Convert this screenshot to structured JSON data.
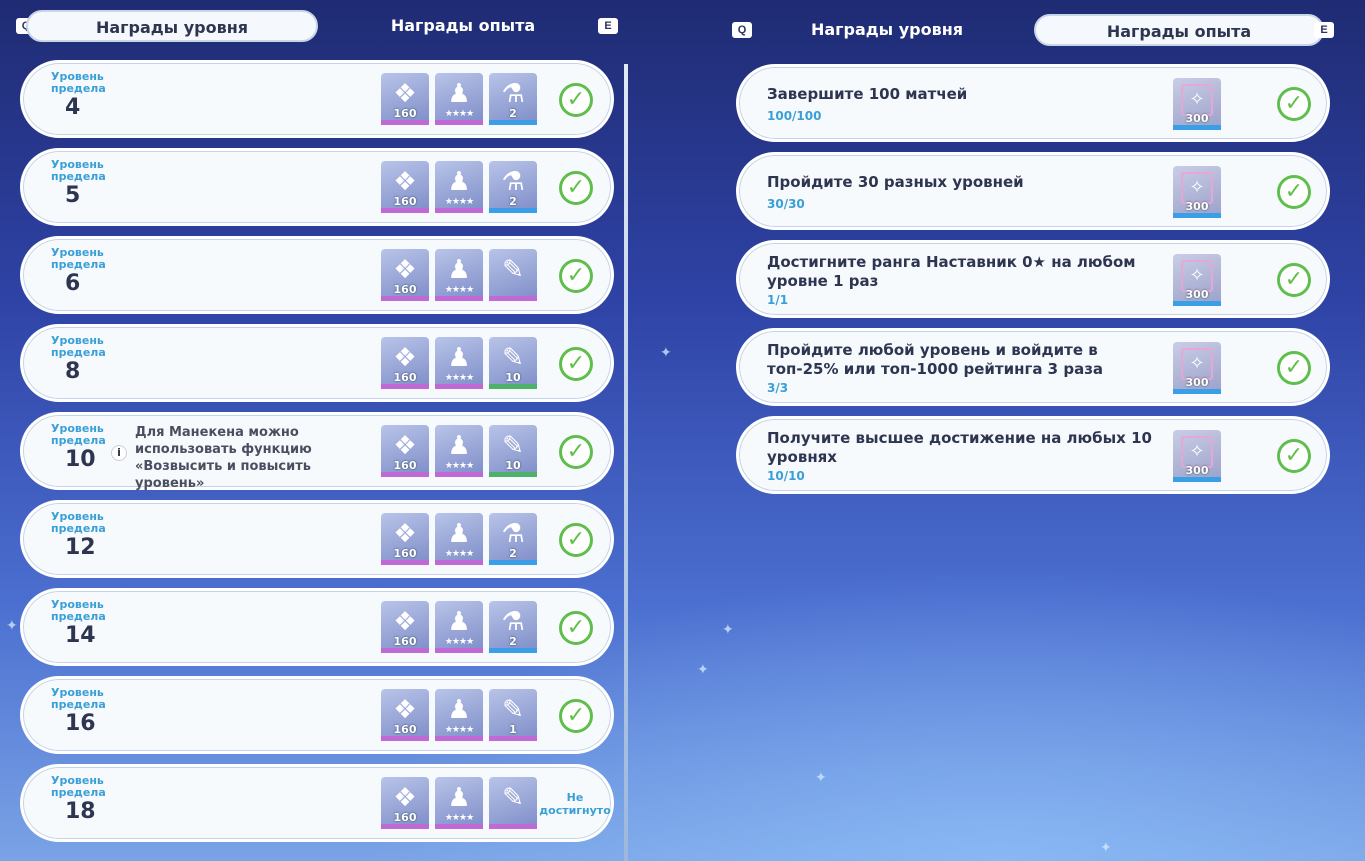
{
  "colors": {
    "accent": "#3a9fd6",
    "check": "#5fbf4c",
    "bar_purple": "#c06ad6",
    "bar_blue": "#3a9fe6",
    "bar_green": "#4cb26a"
  },
  "left": {
    "key_prev": "Q",
    "key_next": "E",
    "tabs": [
      {
        "label": "Награды уровня",
        "active": true
      },
      {
        "label": "Награды опыта",
        "active": false
      }
    ],
    "level_label": "Уровень предела",
    "rows": [
      {
        "level": "4",
        "items": [
          {
            "icon": "crystal-icon",
            "count": "160",
            "bar": "purple"
          },
          {
            "icon": "outfit-icon",
            "count": "★★★★",
            "bar": "purple"
          },
          {
            "icon": "potion-icon",
            "count": "2",
            "bar": "blue"
          }
        ],
        "status": "done"
      },
      {
        "level": "5",
        "items": [
          {
            "icon": "crystal-icon",
            "count": "160",
            "bar": "purple"
          },
          {
            "icon": "outfit-icon",
            "count": "★★★★",
            "bar": "purple"
          },
          {
            "icon": "potion-icon",
            "count": "2",
            "bar": "blue"
          }
        ],
        "status": "done"
      },
      {
        "level": "6",
        "items": [
          {
            "icon": "crystal-icon",
            "count": "160",
            "bar": "purple"
          },
          {
            "icon": "outfit-icon",
            "count": "★★★★",
            "bar": "purple"
          },
          {
            "icon": "brush-icon",
            "count": "",
            "bar": "purple"
          }
        ],
        "status": "done"
      },
      {
        "level": "8",
        "items": [
          {
            "icon": "crystal-icon",
            "count": "160",
            "bar": "purple"
          },
          {
            "icon": "outfit-icon",
            "count": "★★★★",
            "bar": "purple"
          },
          {
            "icon": "brush-icon",
            "count": "10",
            "bar": "green"
          }
        ],
        "status": "done"
      },
      {
        "level": "10",
        "note": "Для Манекена можно использовать функцию «Возвысить и повысить уровень»",
        "items": [
          {
            "icon": "crystal-icon",
            "count": "160",
            "bar": "purple"
          },
          {
            "icon": "outfit-icon",
            "count": "★★★★",
            "bar": "purple"
          },
          {
            "icon": "brush-icon",
            "count": "10",
            "bar": "green"
          }
        ],
        "status": "done"
      },
      {
        "level": "12",
        "items": [
          {
            "icon": "crystal-icon",
            "count": "160",
            "bar": "purple"
          },
          {
            "icon": "outfit-icon",
            "count": "★★★★",
            "bar": "purple"
          },
          {
            "icon": "potion-icon",
            "count": "2",
            "bar": "blue"
          }
        ],
        "status": "done"
      },
      {
        "level": "14",
        "items": [
          {
            "icon": "crystal-icon",
            "count": "160",
            "bar": "purple"
          },
          {
            "icon": "outfit-icon",
            "count": "★★★★",
            "bar": "purple"
          },
          {
            "icon": "potion-icon",
            "count": "2",
            "bar": "blue"
          }
        ],
        "status": "done"
      },
      {
        "level": "16",
        "items": [
          {
            "icon": "crystal-icon",
            "count": "160",
            "bar": "purple"
          },
          {
            "icon": "outfit-icon",
            "count": "★★★★",
            "bar": "purple"
          },
          {
            "icon": "brush-icon",
            "count": "1",
            "bar": "purple"
          }
        ],
        "status": "done"
      },
      {
        "level": "18",
        "items": [
          {
            "icon": "crystal-icon",
            "count": "160",
            "bar": "purple"
          },
          {
            "icon": "outfit-icon",
            "count": "★★★★",
            "bar": "purple"
          },
          {
            "icon": "brush-icon",
            "count": "",
            "bar": "purple"
          }
        ],
        "status": "Не достигнуто"
      }
    ]
  },
  "right": {
    "key_prev": "Q",
    "key_next": "E",
    "tabs": [
      {
        "label": "Награды уровня",
        "active": false
      },
      {
        "label": "Награды опыта",
        "active": true
      }
    ],
    "tasks": [
      {
        "title": "Завершите 100 матчей",
        "progress": "100/100",
        "reward": "300"
      },
      {
        "title": "Пройдите 30 разных уровней",
        "progress": "30/30",
        "reward": "300"
      },
      {
        "title": "Достигните ранга Наставник 0★ на любом уровне 1 раз",
        "progress": "1/1",
        "reward": "300"
      },
      {
        "title": "Пройдите любой уровень и войдите в топ-25% или топ-1000 рейтинга 3 раза",
        "progress": "3/3",
        "reward": "300"
      },
      {
        "title": "Получите высшее достижение на любых 10 уровнях",
        "progress": "10/10",
        "reward": "300"
      }
    ]
  }
}
